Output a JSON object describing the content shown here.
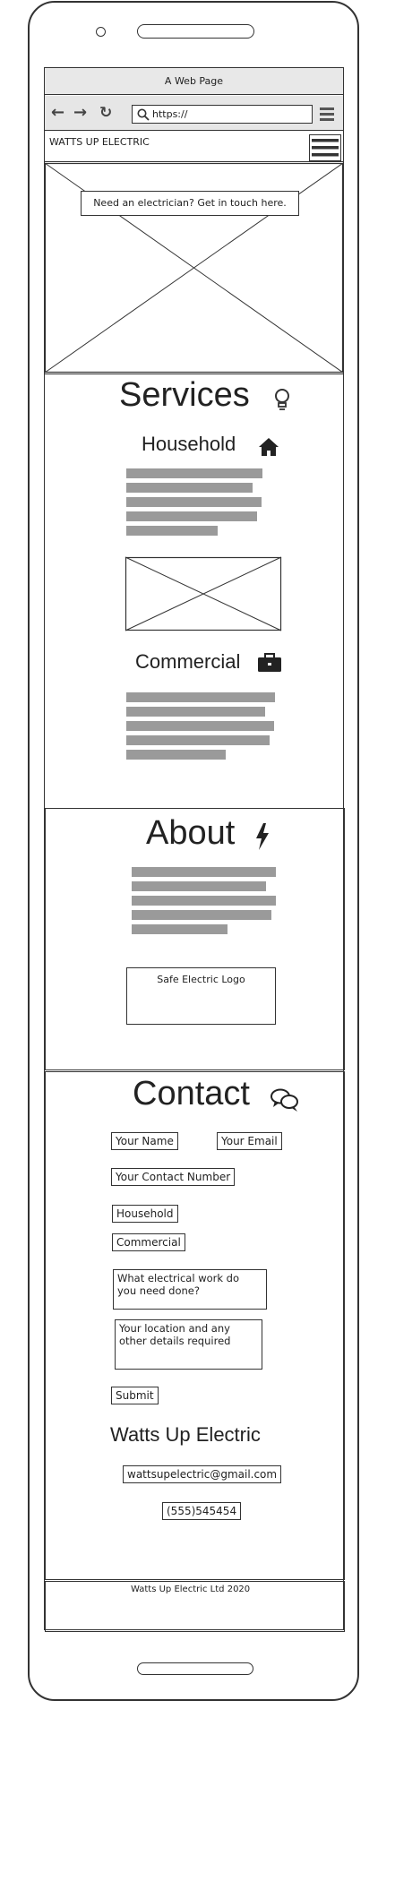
{
  "browser": {
    "title": "A Web Page",
    "url": "https://"
  },
  "site": {
    "brand": "WATTS UP ELECTRIC"
  },
  "hero": {
    "cta": "Need an electrician? Get in touch here."
  },
  "services": {
    "title": "Services",
    "household": "Household",
    "commercial": "Commercial"
  },
  "about": {
    "title": "About",
    "logo_label": "Safe Electric Logo"
  },
  "contact": {
    "title": "Contact",
    "name_placeholder": "Your Name",
    "email_placeholder": "Your Email",
    "number_placeholder": "Your Contact Number",
    "option_household": "Household",
    "option_commercial": "Commercial",
    "work_line1": "What electrical work do",
    "work_line2": "you need done?",
    "location_line1": "Your location and any",
    "location_line2": "other details required",
    "submit": "Submit",
    "company": "Watts Up Electric",
    "email": "wattsupelectric@gmail.com",
    "phone": "(555)545454"
  },
  "footer": {
    "text": "Watts Up Electric Ltd 2020"
  },
  "icons": {
    "back": "arrow-left-icon",
    "forward": "arrow-right-icon",
    "reload": "reload-icon",
    "search": "search-icon",
    "menu": "hamburger-menu-icon",
    "services": "lightbulb-icon",
    "household": "home-icon",
    "commercial": "briefcase-icon",
    "about": "lightning-bolt-icon",
    "contact": "chat-bubbles-icon"
  }
}
